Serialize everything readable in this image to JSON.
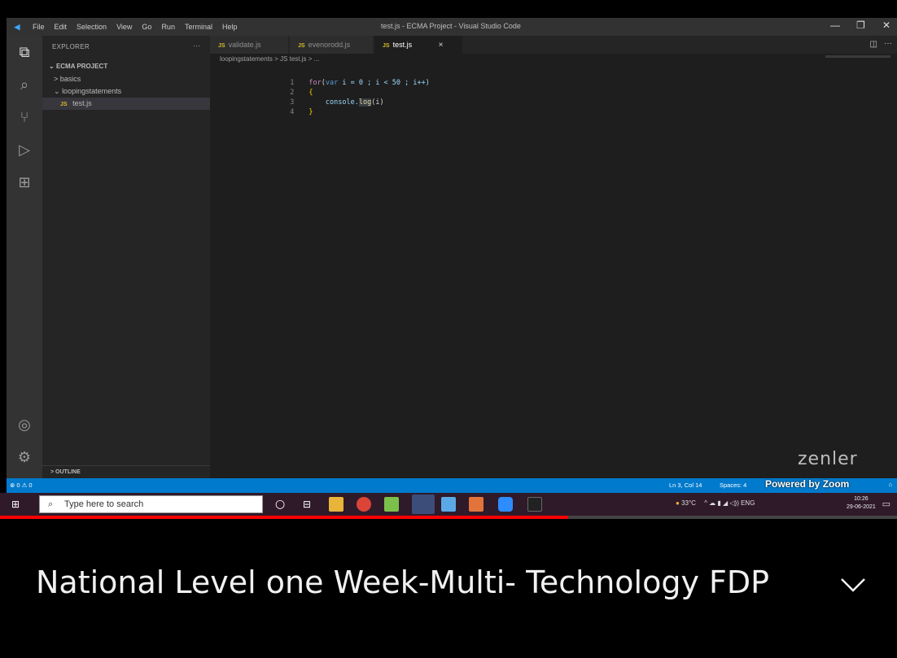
{
  "window": {
    "title": "test.js - ECMA Project - Visual Studio Code",
    "menu": [
      "File",
      "Edit",
      "Selection",
      "View",
      "Go",
      "Run",
      "Terminal",
      "Help"
    ]
  },
  "sidebar": {
    "title": "EXPLORER",
    "more": "···",
    "project": "ECMA PROJECT",
    "items": [
      {
        "label": "basics",
        "chevron": ">"
      },
      {
        "label": "loopingstatements",
        "chevron": "v"
      },
      {
        "label": "test.js",
        "badge": "JS"
      }
    ],
    "outline": "OUTLINE"
  },
  "tabs": [
    {
      "label": "validate.js",
      "badge": "JS"
    },
    {
      "label": "evenorodd.js",
      "badge": "JS"
    },
    {
      "label": "test.js",
      "badge": "JS",
      "close": "×"
    }
  ],
  "breadcrumb": "loopingstatements > JS test.js > ...",
  "code": {
    "line_numbers": [
      "1",
      "2",
      "3",
      "4"
    ],
    "line1": {
      "kw": "for",
      "open": "(",
      "var": "var",
      "rest": " i = 0 ; i < 50 ; i++)"
    },
    "line2": "{",
    "line3": {
      "obj": "console.",
      "fn": "log",
      "args": "(i)"
    },
    "line4": "}"
  },
  "statusbar": {
    "problems": "⊗ 0 ⚠ 0",
    "cursor": "Ln 3, Col 14",
    "spaces": "Spaces: 4"
  },
  "taskbar": {
    "search_placeholder": "Type here to search",
    "weather": "33°C",
    "tray": "^ ☁ ▮ ◢ ◁)) ENG",
    "time": "10:26",
    "date": "29-06-2021"
  },
  "overlay": {
    "watermark": "zenler",
    "zoom": "Powered by Zoom"
  },
  "video": {
    "title": "National Level one Week-Multi- Technology FDP",
    "progress": 0.633
  },
  "colors": {
    "accent": "#007acc",
    "progress": "#ff0000"
  }
}
